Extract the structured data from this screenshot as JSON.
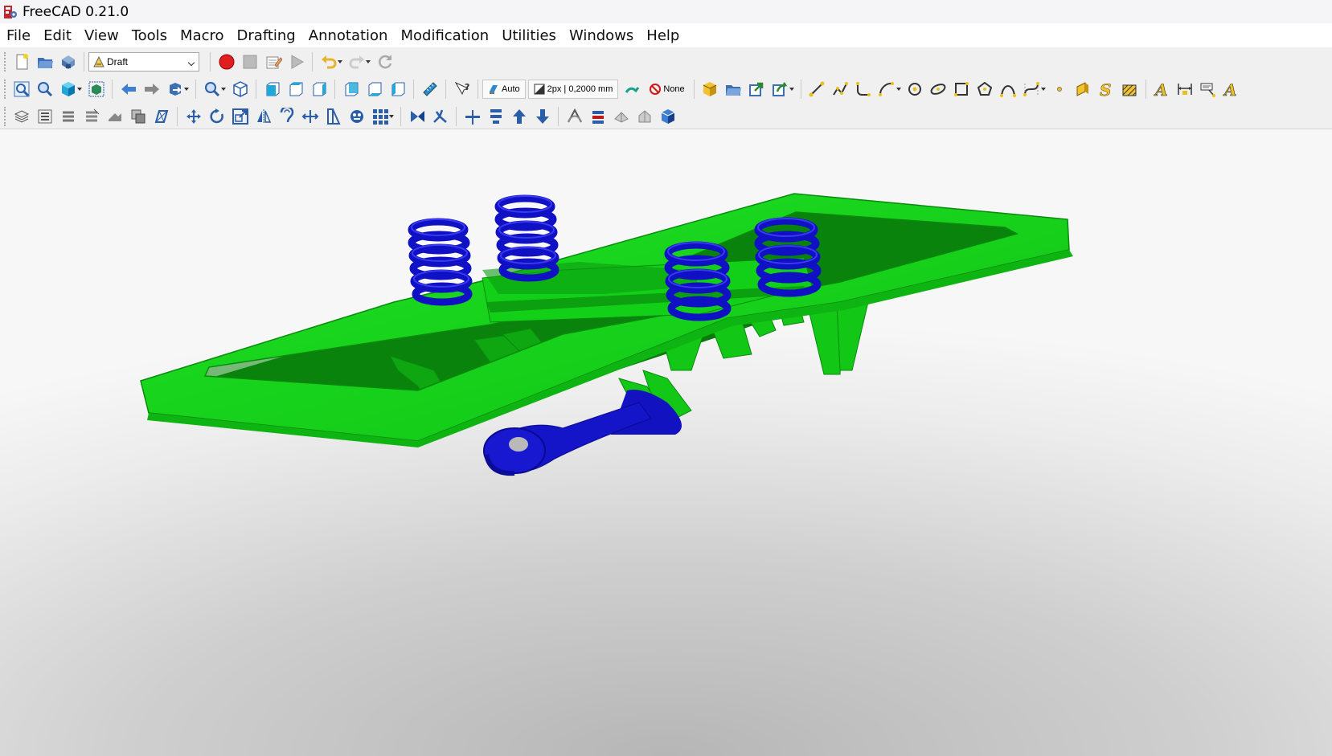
{
  "window": {
    "title": "FreeCAD 0.21.0"
  },
  "menu": [
    "File",
    "Edit",
    "View",
    "Tools",
    "Macro",
    "Drafting",
    "Annotation",
    "Modification",
    "Utilities",
    "Windows",
    "Help"
  ],
  "workbench": {
    "selected": "Draft"
  },
  "snap": {
    "working_plane": "Auto",
    "line_style": "2px | 0,2000 mm",
    "construction": "None"
  },
  "colors": {
    "frame_green": "#16d21c",
    "frame_dark": "#0a7a0c",
    "springs_blue": "#1414c8",
    "record_red": "#e02020"
  },
  "icons": {
    "file_toolbar": [
      "new-document-icon",
      "open-folder-icon",
      "save-icon"
    ],
    "macro_toolbar": [
      "record-macro-icon",
      "stop-macro-icon",
      "edit-macro-icon",
      "run-macro-icon"
    ],
    "edit_toolbar": [
      "undo-icon",
      "redo-icon",
      "refresh-icon"
    ],
    "view_toolbar": [
      "fit-all-icon",
      "fit-selection-icon",
      "draw-style-icon",
      "bounding-box-icon",
      "back-icon",
      "forward-icon",
      "sync-view-icon",
      "zoom-icon",
      "isometric-view-icon",
      "front-view-icon",
      "top-view-icon",
      "right-view-icon",
      "rear-view-icon",
      "bottom-view-icon",
      "left-view-icon",
      "measure-icon",
      "whats-this-icon"
    ],
    "draft_create_toolbar": [
      "new-part-icon",
      "new-group-icon",
      "link-icon",
      "link-actions-icon",
      "line-icon",
      "wire-icon",
      "fillet-icon",
      "arc-icon",
      "circle-icon",
      "ellipse-icon",
      "rectangle-icon",
      "polygon-icon",
      "bspline-icon",
      "bezier-icon",
      "point-icon",
      "facebinder-icon",
      "shapestring-icon",
      "hatch-icon",
      "text-icon",
      "dimension-icon",
      "label-icon",
      "annotation-style-icon"
    ],
    "draft_modify_toolbar": [
      "layer-icon",
      "add-to-group-icon",
      "select-group-icon",
      "add-construction-icon",
      "toggle-display-icon",
      "subelement-highlight-icon",
      "working-plane-proxy-icon",
      "move-icon",
      "rotate-icon",
      "scale-icon",
      "mirror-icon",
      "offset-icon",
      "stretch-icon",
      "trimex-icon",
      "clone-icon",
      "array-icon",
      "join-icon",
      "split-icon",
      "upgrade-icon",
      "downgrade-icon",
      "heal-icon",
      "wire-to-bspline-icon",
      "draft-to-sketch-icon",
      "shape-2d-view-icon",
      "edit-icon",
      "slope-icon",
      "flip-dimension-icon"
    ]
  }
}
